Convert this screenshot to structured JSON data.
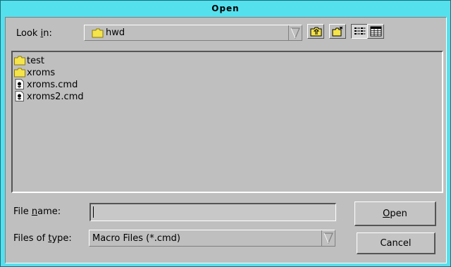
{
  "window": {
    "title": "Open"
  },
  "look_in": {
    "label_pre": "Look ",
    "label_mnemonic": "i",
    "label_post": "n:",
    "value": "hwd"
  },
  "toolbar": {
    "up_folder_icon": "up-folder-icon",
    "new_folder_icon": "new-folder-icon",
    "list_view_icon": "list-view-icon",
    "details_view_icon": "details-view-icon"
  },
  "files": [
    {
      "name": "test",
      "type": "folder"
    },
    {
      "name": "xroms",
      "type": "folder"
    },
    {
      "name": "xroms.cmd",
      "type": "file"
    },
    {
      "name": "xroms2.cmd",
      "type": "file"
    }
  ],
  "file_name": {
    "label_pre": "File ",
    "label_mnemonic": "n",
    "label_post": "ame:",
    "value": ""
  },
  "files_of_type": {
    "label_pre": "Files of ",
    "label_mnemonic": "t",
    "label_post": "ype:",
    "value": "Macro  Files (*.cmd)"
  },
  "buttons": {
    "open_mnemonic": "O",
    "open_rest": "pen",
    "cancel": "Cancel"
  },
  "colors": {
    "frame": "#55e0ee",
    "face": "#bfbfbf",
    "folder": "#f5e44a"
  }
}
